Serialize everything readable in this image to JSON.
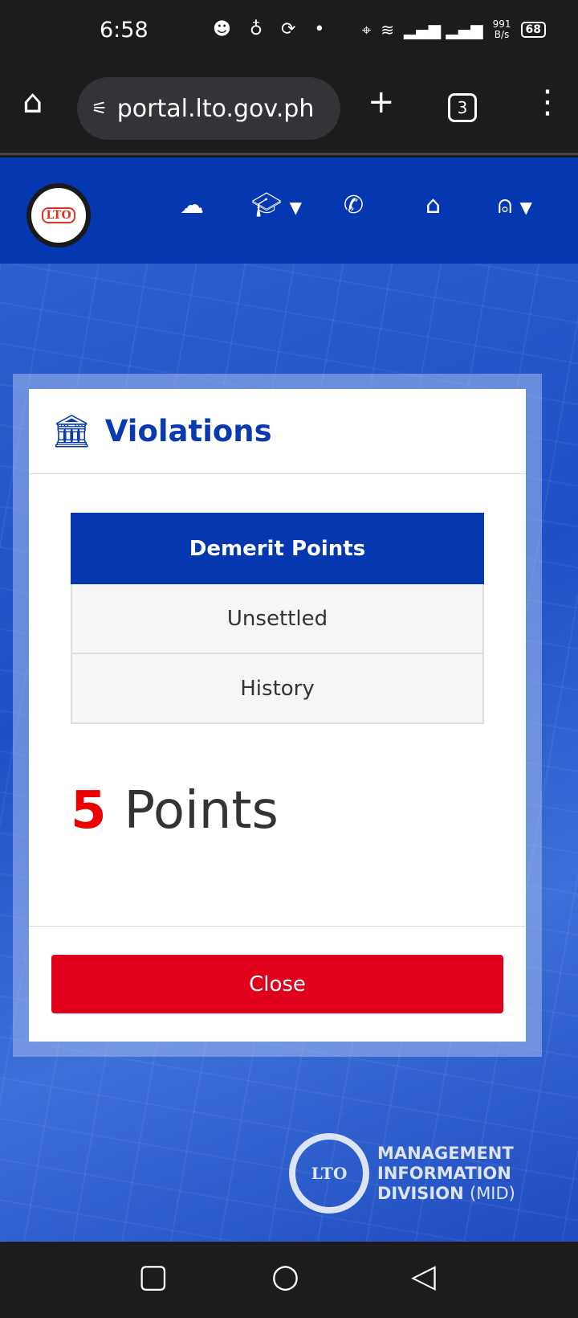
{
  "status_bar": {
    "time": "6:58",
    "speed_value": "991",
    "speed_unit": "B/s",
    "battery": "68"
  },
  "browser": {
    "url": "portal.lto.gov.ph",
    "tab_count": "3"
  },
  "nav": {
    "logo_text": "LTO",
    "icons": [
      "cloud-icon",
      "graduation-cap-icon",
      "phone-icon",
      "home-icon",
      "user-icon"
    ]
  },
  "modal": {
    "title": "Violations",
    "table": {
      "header": "Demerit Points",
      "rows": [
        "Unsettled",
        "History"
      ]
    },
    "points_value": "5",
    "points_label": "Points",
    "close_label": "Close"
  },
  "footer_logo": {
    "badge": "LTO",
    "line1": "MANAGEMENT",
    "line2": "INFORMATION",
    "line3": "DIVISION",
    "line3_suffix": "(MID)"
  },
  "colors": {
    "brand_blue": "#0437b0",
    "close_red": "#e0001b",
    "points_red": "#ee0000"
  }
}
